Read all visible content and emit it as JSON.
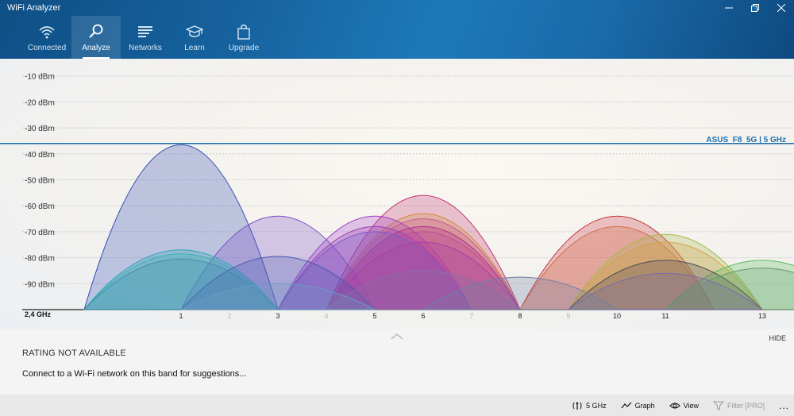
{
  "window": {
    "title": "WiFi Analyzer",
    "controls": [
      "minimize-icon",
      "maximize-icon",
      "close-icon"
    ]
  },
  "nav": {
    "items": [
      {
        "label": "Connected",
        "icon": "wifi-icon",
        "active": false
      },
      {
        "label": "Analyze",
        "icon": "magnifier-icon",
        "active": true
      },
      {
        "label": "Networks",
        "icon": "list-icon",
        "active": false
      },
      {
        "label": "Learn",
        "icon": "graduation-cap-icon",
        "active": false
      },
      {
        "label": "Upgrade",
        "icon": "shopping-bag-icon",
        "active": false
      }
    ]
  },
  "chart": {
    "band_label": "2,4 GHz",
    "highlight_label": "ASUS_F8_5G | 5 GHz",
    "highlight_color": "#1c6eb0"
  },
  "chart_data": {
    "type": "area",
    "xlabel": "2,4 GHz",
    "ylabel": "",
    "ylim": [
      -100,
      -5
    ],
    "y_ticks": [
      "-10 dBm",
      "-20 dBm",
      "-30 dBm",
      "-40 dBm",
      "-50 dBm",
      "-60 dBm",
      "-70 dBm",
      "-80 dBm",
      "-90 dBm"
    ],
    "x_ticks": [
      {
        "label": "1",
        "value": 1,
        "dim": false
      },
      {
        "label": "2",
        "value": 2,
        "dim": true
      },
      {
        "label": "3",
        "value": 3,
        "dim": false
      },
      {
        "label": "4",
        "value": 4,
        "dim": true
      },
      {
        "label": "5",
        "value": 5,
        "dim": false
      },
      {
        "label": "6",
        "value": 6,
        "dim": false
      },
      {
        "label": "7",
        "value": 7,
        "dim": true
      },
      {
        "label": "8",
        "value": 8,
        "dim": false
      },
      {
        "label": "9",
        "value": 9,
        "dim": true
      },
      {
        "label": "10",
        "value": 10,
        "dim": false
      },
      {
        "label": "11",
        "value": 11,
        "dim": false
      },
      {
        "label": "13",
        "value": 13,
        "dim": false
      }
    ],
    "reference_line": {
      "value": -36
    },
    "series": [
      {
        "channel": 1,
        "signal": -36.5,
        "color": "#2f4db3"
      },
      {
        "channel": 1,
        "signal": -77,
        "color": "#2aa6b8"
      },
      {
        "channel": 1,
        "signal": -78.5,
        "color": "#37b3b0"
      },
      {
        "channel": 1,
        "signal": -80.5,
        "color": "#3e8fa8"
      },
      {
        "channel": 3,
        "signal": -64,
        "color": "#7b4ec9"
      },
      {
        "channel": 3,
        "signal": -79.5,
        "color": "#4a5ab0"
      },
      {
        "channel": 3,
        "signal": -90,
        "color": "#6b9bc2"
      },
      {
        "channel": 5,
        "signal": -64,
        "color": "#a23cc4"
      },
      {
        "channel": 5,
        "signal": -68,
        "color": "#9a3fb3"
      },
      {
        "channel": 5,
        "signal": -70,
        "color": "#7a5ac6"
      },
      {
        "channel": 6,
        "signal": -56,
        "color": "#c0346e"
      },
      {
        "channel": 6,
        "signal": -63,
        "color": "#d48a3c"
      },
      {
        "channel": 6,
        "signal": -65,
        "color": "#c65b8f"
      },
      {
        "channel": 6,
        "signal": -68,
        "color": "#b0308a"
      },
      {
        "channel": 6,
        "signal": -70,
        "color": "#c04a9a"
      },
      {
        "channel": 6,
        "signal": -74,
        "color": "#a83fa0"
      },
      {
        "channel": 6,
        "signal": -85,
        "color": "#8a6fa5"
      },
      {
        "channel": 8,
        "signal": -87.5,
        "color": "#6f7ea5"
      },
      {
        "channel": 10,
        "signal": -64,
        "color": "#c8343e"
      },
      {
        "channel": 10,
        "signal": -68,
        "color": "#d36a4a"
      },
      {
        "channel": 11,
        "signal": -71,
        "color": "#a6b848"
      },
      {
        "channel": 11,
        "signal": -74,
        "color": "#d4a04a"
      },
      {
        "channel": 11,
        "signal": -81,
        "color": "#4a4a55"
      },
      {
        "channel": 11,
        "signal": -86,
        "color": "#7a6aa8"
      },
      {
        "channel": 13,
        "signal": -81,
        "color": "#5abb5a"
      },
      {
        "channel": 13,
        "signal": -84,
        "color": "#6aa070"
      }
    ]
  },
  "info": {
    "rating": "RATING NOT AVAILABLE",
    "suggestion": "Connect to a Wi-Fi network on this band for suggestions...",
    "hide_label": "HIDE"
  },
  "commandbar": {
    "band": {
      "label": "5 GHz",
      "icon": "band-antenna-icon"
    },
    "graph": {
      "label": "Graph",
      "icon": "graph-line-icon"
    },
    "view": {
      "label": "View",
      "icon": "eye-icon"
    },
    "filter": {
      "label": "Filter [PRO]",
      "icon": "filter-icon",
      "disabled": true
    },
    "more_label": "..."
  }
}
